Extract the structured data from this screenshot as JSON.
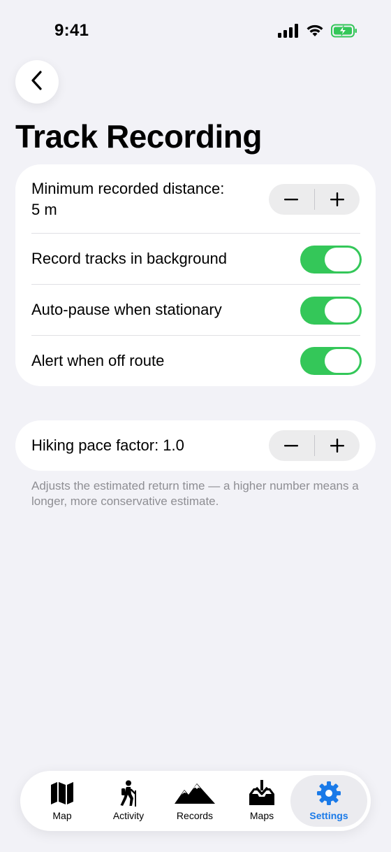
{
  "status_bar": {
    "time": "9:41",
    "icons": [
      "cellular-signal-icon",
      "wifi-icon",
      "battery-charging-icon"
    ]
  },
  "header": {
    "back_icon": "chevron-left-icon",
    "title": "Track Recording"
  },
  "recording_section": {
    "min_distance": {
      "label_line1": "Minimum recorded distance:",
      "label_line2": "5 m",
      "decrement_symbol": "−",
      "increment_symbol": "+"
    },
    "toggles": [
      {
        "label": "Record tracks in background",
        "on": true
      },
      {
        "label": "Auto-pause when stationary",
        "on": true
      },
      {
        "label": "Alert when off route",
        "on": true
      }
    ]
  },
  "pace_section": {
    "label": "Hiking pace factor: 1.0",
    "decrement_symbol": "−",
    "increment_symbol": "+",
    "footnote": "Adjusts the estimated return time — a higher number means a longer, more conservative estimate."
  },
  "tab_bar": {
    "tabs": [
      {
        "label": "Map",
        "icon": "map-icon",
        "active": false
      },
      {
        "label": "Activity",
        "icon": "hiker-icon",
        "active": false
      },
      {
        "label": "Records",
        "icon": "mountains-icon",
        "active": false
      },
      {
        "label": "Maps",
        "icon": "download-tray-icon",
        "active": false
      },
      {
        "label": "Settings",
        "icon": "gear-icon",
        "active": true
      }
    ]
  },
  "colors": {
    "background": "#f2f2f7",
    "toggle_on": "#34c759",
    "accent": "#1a7ae8",
    "secondary_text": "#8e8e93"
  }
}
